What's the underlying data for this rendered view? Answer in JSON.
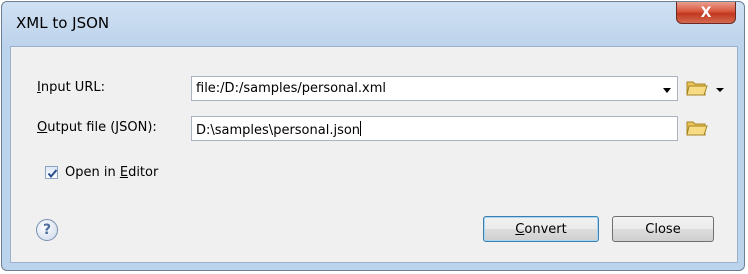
{
  "window": {
    "title": "XML to JSON",
    "close_glyph": "X"
  },
  "form": {
    "input_url": {
      "label_mnemonic": "I",
      "label_rest": "nput URL:",
      "value": "file:/D:/samples/personal.xml"
    },
    "output_file": {
      "label_mnemonic": "O",
      "label_rest": "utput file (JSON):",
      "value": "D:\\samples\\personal.json"
    },
    "open_in_editor": {
      "label_prefix": "Open in ",
      "label_mnemonic": "E",
      "label_rest": "ditor",
      "checked": true
    }
  },
  "buttons": {
    "help_glyph": "?",
    "convert": {
      "mnemonic": "C",
      "rest": "onvert"
    },
    "close": "Close"
  },
  "icons": [
    "folder-icon",
    "chevron-down-icon",
    "check-icon",
    "help-icon",
    "close-icon"
  ]
}
